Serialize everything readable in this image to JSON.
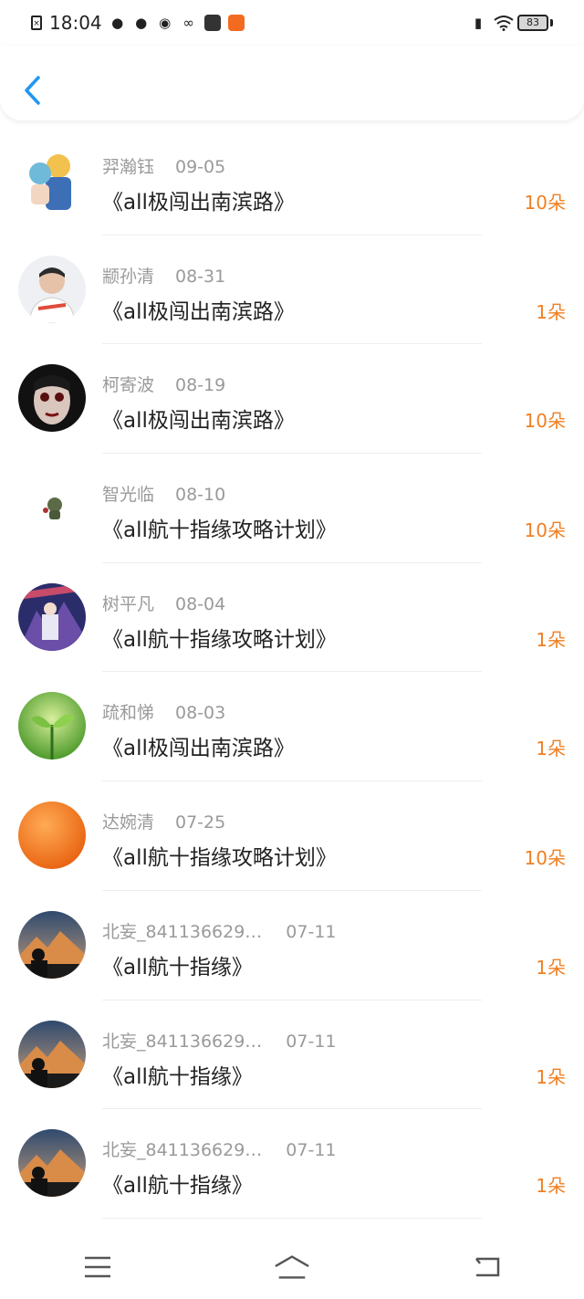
{
  "status_bar": {
    "time": "18:04",
    "battery": "83"
  },
  "accent_color": "#2196f3",
  "amount_color": "#f07f22",
  "rows": [
    {
      "name": "羿瀚钰",
      "date": "09-05",
      "title": "《all极闯出南滨路》",
      "amount": "10朵",
      "avatar": "anime-avatar"
    },
    {
      "name": "颛孙清",
      "date": "08-31",
      "title": "《all极闯出南滨路》",
      "amount": "1朵",
      "avatar": "person-avatar"
    },
    {
      "name": "柯寄波",
      "date": "08-19",
      "title": "《all极闯出南滨路》",
      "amount": "10朵",
      "avatar": "face-avatar"
    },
    {
      "name": "智光临",
      "date": "08-10",
      "title": "《all航十指缘攻略计划》",
      "amount": "10朵",
      "avatar": "sticker-avatar"
    },
    {
      "name": "树平凡",
      "date": "08-04",
      "title": "《all航十指缘攻略计划》",
      "amount": "1朵",
      "avatar": "artwork-avatar"
    },
    {
      "name": "疏和悌",
      "date": "08-03",
      "title": "《all极闯出南滨路》",
      "amount": "1朵",
      "avatar": "sprout-avatar"
    },
    {
      "name": "达婉清",
      "date": "07-25",
      "title": "《all航十指缘攻略计划》",
      "amount": "10朵",
      "avatar": "orange-avatar"
    },
    {
      "name": "北妄_841136629…",
      "date": "07-11",
      "title": "《all航十指缘》",
      "amount": "1朵",
      "avatar": "mountain-avatar"
    },
    {
      "name": "北妄_841136629…",
      "date": "07-11",
      "title": "《all航十指缘》",
      "amount": "1朵",
      "avatar": "mountain-avatar"
    },
    {
      "name": "北妄_841136629…",
      "date": "07-11",
      "title": "《all航十指缘》",
      "amount": "1朵",
      "avatar": "mountain-avatar"
    }
  ]
}
